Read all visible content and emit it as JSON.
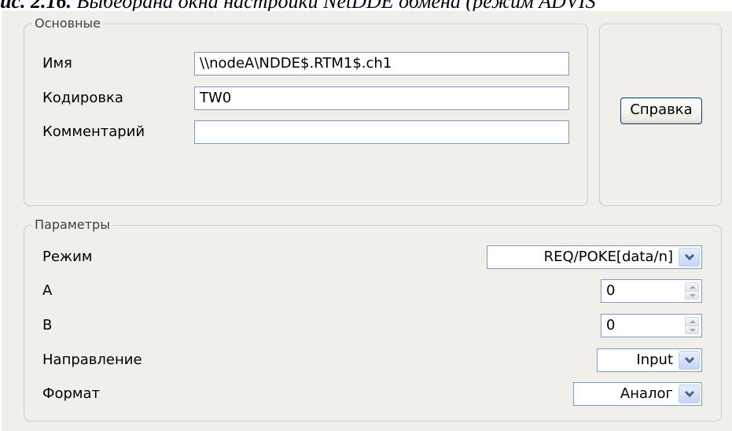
{
  "caption": {
    "prefix": "ис. 2.16.",
    "text": "Выбеорана окна настройки NetDDE обмена (режим ADVIS"
  },
  "basic": {
    "title": "Основные",
    "name_label": "Имя",
    "name_value": "\\\\nodeA\\NDDE$.RTM1$.ch1",
    "encoding_label": "Кодировка",
    "encoding_value": "TW0",
    "comment_label": "Комментарий",
    "comment_value": ""
  },
  "help_button": "Справка",
  "params": {
    "title": "Параметры",
    "mode_label": "Режим",
    "mode_value": "REQ/POKE[data/n]",
    "a_label": "A",
    "a_value": "0",
    "b_label": "B",
    "b_value": "0",
    "direction_label": "Направление",
    "direction_value": "Input",
    "format_label": "Формат",
    "format_value": "Аналог"
  },
  "icons": {
    "dropdown": "chevron-down-icon",
    "spin_up": "spin-up-icon",
    "spin_down": "spin-down-icon"
  }
}
